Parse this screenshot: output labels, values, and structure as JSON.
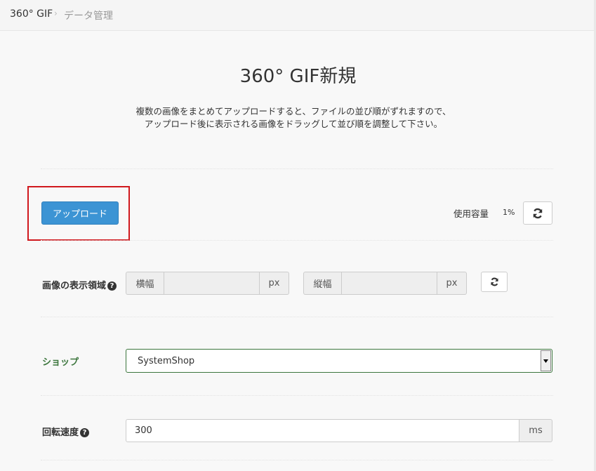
{
  "breadcrumb": {
    "root": "360° GIF",
    "separator": "›",
    "current": "データ管理"
  },
  "page": {
    "title": "360° GIF新規",
    "description_line1": "複数の画像をまとめてアップロードすると、ファイルの並び順がずれますので、",
    "description_line2": "アップロード後に表示される画像をドラッグして並び順を調整して下さい。"
  },
  "upload": {
    "button_label": "アップロード",
    "usage_label": "使用容量",
    "usage_value": "1%",
    "refresh_icon": "refresh-icon"
  },
  "display_area": {
    "label": "画像の表示領域",
    "help_icon": "?",
    "width_label": "横幅",
    "width_value": "",
    "width_unit": "px",
    "height_label": "縦幅",
    "height_value": "",
    "height_unit": "px"
  },
  "shop": {
    "label": "ショップ",
    "selected": "SystemShop"
  },
  "speed": {
    "label": "回転速度",
    "help_icon": "?",
    "value": "300",
    "unit": "ms"
  },
  "colors": {
    "accent": "#3c94d4",
    "highlight": "#d0181d",
    "success": "#3c763d"
  }
}
